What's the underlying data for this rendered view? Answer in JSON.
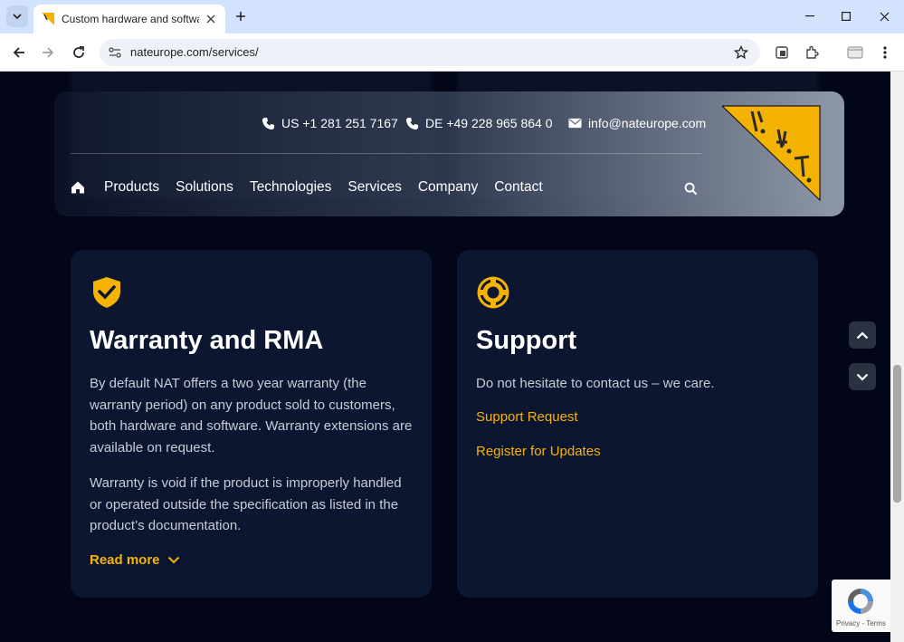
{
  "browser": {
    "tab_title": "Custom hardware and software",
    "url": "nateurope.com/services/"
  },
  "header": {
    "phone_us": "US +1 281 251 7167",
    "phone_de": "DE +49 228 965 864 0",
    "email": "info@nateurope.com",
    "menu": [
      "Products",
      "Solutions",
      "Technologies",
      "Services",
      "Company",
      "Contact"
    ]
  },
  "cards": {
    "warranty": {
      "title": "Warranty and RMA",
      "paragraph1": "By default NAT offers a two year warranty (the warranty period) on any product sold to customers, both hardware and software. Warranty extensions are available on request.",
      "paragraph2": "Warranty is void if the product is improperly handled or operated outside the specification as listed in the product’s documentation.",
      "read_more": "Read more"
    },
    "support": {
      "title": "Support",
      "paragraph": "Do not hesitate to contact us – we care.",
      "link1": "Support Request",
      "link2": "Register for Updates"
    }
  },
  "recaptcha": {
    "terms": "Privacy - Terms"
  },
  "colors": {
    "accent": "#f5b301",
    "page_bg": "#020617",
    "card_bg": "#0c1631"
  }
}
